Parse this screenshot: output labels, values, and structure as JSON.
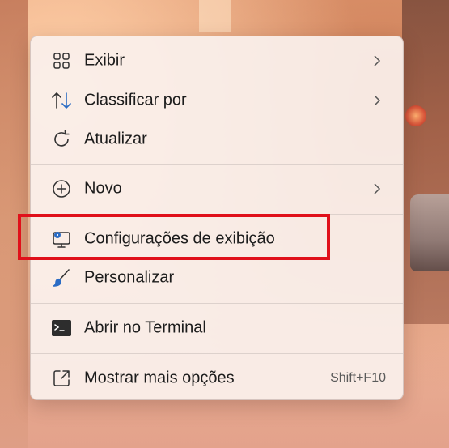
{
  "context_menu": {
    "items": [
      {
        "label": "Exibir",
        "icon": "grid-icon",
        "has_submenu": true
      },
      {
        "label": "Classificar por",
        "icon": "sort-icon",
        "has_submenu": true
      },
      {
        "label": "Atualizar",
        "icon": "refresh-icon",
        "has_submenu": false
      },
      {
        "label": "Novo",
        "icon": "plus-circle-icon",
        "has_submenu": true
      },
      {
        "label": "Configurações de exibição",
        "icon": "display-settings-icon",
        "has_submenu": false
      },
      {
        "label": "Personalizar",
        "icon": "brush-icon",
        "has_submenu": false
      },
      {
        "label": "Abrir no Terminal",
        "icon": "terminal-icon",
        "has_submenu": false
      },
      {
        "label": "Mostrar mais opções",
        "icon": "expand-icon",
        "has_submenu": false,
        "shortcut": "Shift+F10"
      }
    ]
  },
  "highlight": {
    "color": "#e0101a",
    "target": "Configurações de exibição"
  },
  "colors": {
    "icon_blue": "#2b6cc4",
    "menu_bg": "#faf0ec",
    "text": "#1c1c1c"
  }
}
